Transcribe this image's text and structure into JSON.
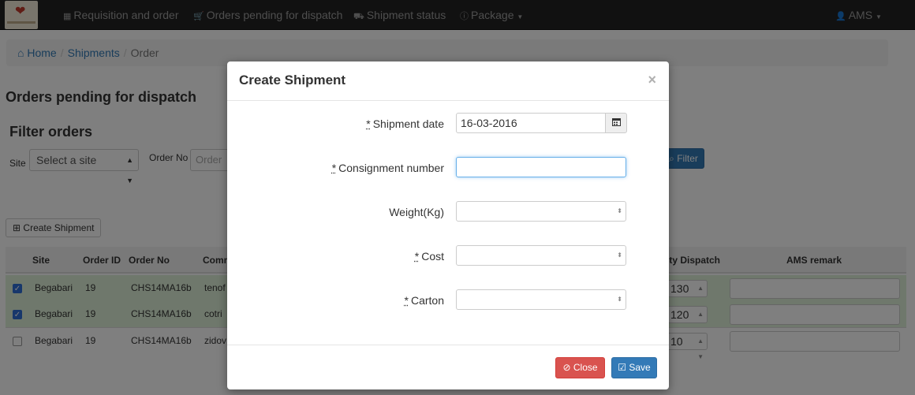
{
  "nav": {
    "items": [
      {
        "icon": "table-icon",
        "glyph": "▦",
        "label": "Requisition and order"
      },
      {
        "icon": "cart-icon",
        "glyph": "🛒",
        "label": "Orders pending for dispatch"
      },
      {
        "icon": "truck-icon",
        "glyph": "⛟",
        "label": "Shipment status"
      },
      {
        "icon": "info-icon",
        "glyph": "ⓘ",
        "label": "Package"
      }
    ],
    "user": "AMS"
  },
  "breadcrumb": {
    "home": "Home",
    "shipments": "Shipments",
    "current": "Order"
  },
  "page": {
    "title": "Orders pending for dispatch",
    "filter_title": "Filter orders",
    "site_label": "Site",
    "site_selected": "Select a site",
    "order_no_label": "Order No",
    "order_no_placeholder": "Order N",
    "filter_button": "Filter",
    "create_button": "Create Shipment"
  },
  "table": {
    "headers": {
      "site": "Site",
      "order_id": "Order ID",
      "order_no": "Order No",
      "commodity": "Comm",
      "qty_dispatch": "ity Dispatch",
      "ams_remark": "AMS remark"
    },
    "rows": [
      {
        "checked": true,
        "site": "Begabari",
        "order_id": "19",
        "order_no": "CHS14MA16b",
        "commodity": "tenof",
        "qty": "130"
      },
      {
        "checked": true,
        "site": "Begabari",
        "order_id": "19",
        "order_no": "CHS14MA16b",
        "commodity": "cotri",
        "qty": "120"
      },
      {
        "checked": false,
        "site": "Begabari",
        "order_id": "19",
        "order_no": "CHS14MA16b",
        "commodity": "zidov",
        "qty": "10"
      }
    ]
  },
  "modal": {
    "title": "Create Shipment",
    "close_x": "×",
    "required_mark": "*",
    "fields": {
      "shipment_date": {
        "label": "Shipment date",
        "value": "16-03-2016"
      },
      "consignment_number": {
        "label": "Consignment number",
        "value": ""
      },
      "weight": {
        "label": "Weight(Kg)",
        "value": ""
      },
      "cost": {
        "label": "Cost",
        "value": ""
      },
      "carton": {
        "label": "Carton",
        "value": ""
      }
    },
    "close_button": "Close",
    "save_button": "Save"
  },
  "colors": {
    "navbar": "#222222",
    "primary": "#337ab7",
    "danger": "#d9534f",
    "row_selected": "#dff0d8"
  }
}
